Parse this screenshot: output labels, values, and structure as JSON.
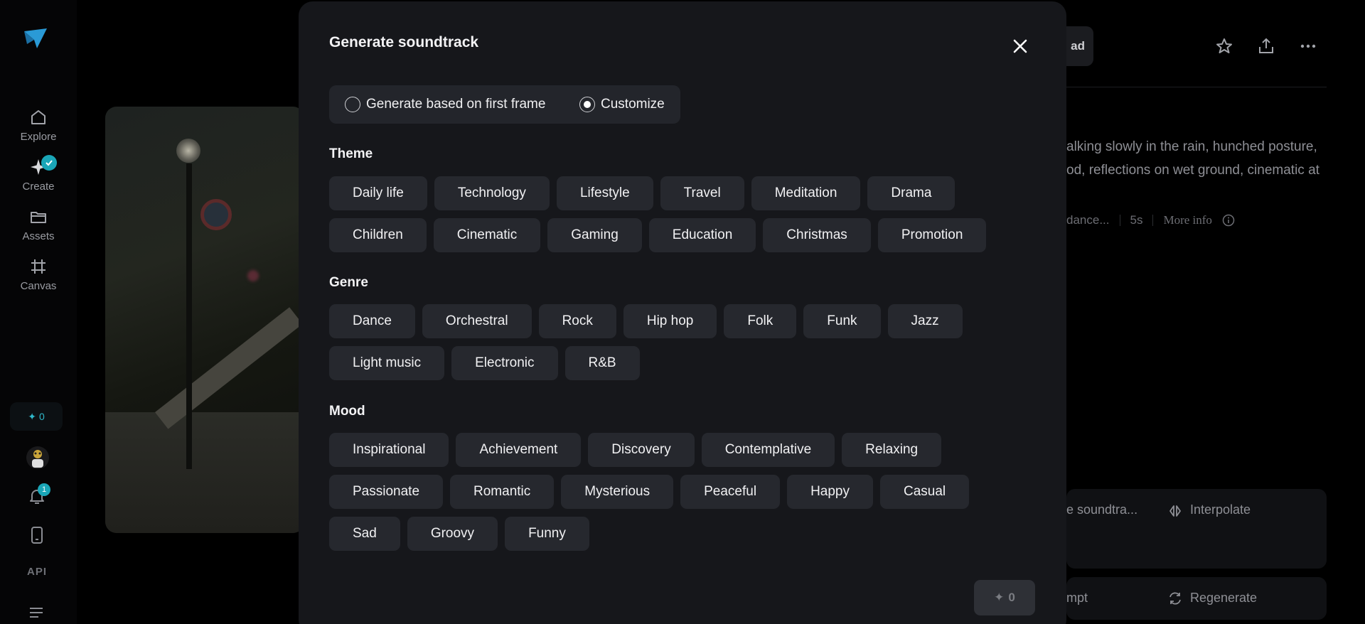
{
  "sidebar": {
    "items": [
      {
        "label": "Explore"
      },
      {
        "label": "Create"
      },
      {
        "label": "Assets"
      },
      {
        "label": "Canvas"
      }
    ],
    "credits": "0",
    "notification_count": "1",
    "api_label": "API"
  },
  "background": {
    "top_button_label": "ad",
    "prompt_line1": "alking slowly in the rain, hunched posture,",
    "prompt_line2": "od, reflections on wet ground, cinematic at",
    "meta": {
      "model": "dance...",
      "duration": "5s",
      "more_info": "More info"
    },
    "actions": {
      "soundtrack": "e soundtra...",
      "interpolate": "Interpolate",
      "prompt": "mpt",
      "regenerate": "Regenerate"
    }
  },
  "modal": {
    "title": "Generate soundtrack",
    "mode": {
      "option_first_frame": "Generate based on first frame",
      "option_customize": "Customize",
      "selected": "Customize"
    },
    "theme": {
      "title": "Theme",
      "row1": [
        "Daily life",
        "Technology",
        "Lifestyle",
        "Travel",
        "Meditation",
        "Drama"
      ],
      "row2": [
        "Children",
        "Cinematic",
        "Gaming",
        "Education",
        "Christmas",
        "Promotion"
      ]
    },
    "genre": {
      "title": "Genre",
      "row1": [
        "Dance",
        "Orchestral",
        "Rock",
        "Hip hop",
        "Folk",
        "Funk",
        "Jazz"
      ],
      "row2": [
        "Light music",
        "Electronic",
        "R&B"
      ]
    },
    "mood": {
      "title": "Mood",
      "row1": [
        "Inspirational",
        "Achievement",
        "Discovery",
        "Contemplative",
        "Relaxing"
      ],
      "row2": [
        "Passionate",
        "Romantic",
        "Mysterious",
        "Peaceful",
        "Happy",
        "Casual"
      ],
      "row3": [
        "Sad",
        "Groovy",
        "Funny"
      ]
    },
    "generate_cost": "0"
  },
  "colors": {
    "accent": "#1aa6b7",
    "modal_bg": "#16171b",
    "chip_bg": "#26282e"
  }
}
